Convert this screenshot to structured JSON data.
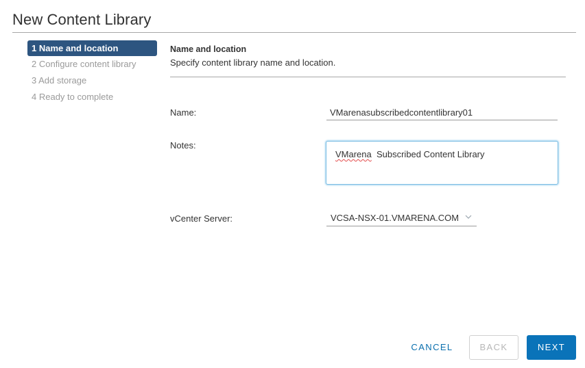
{
  "dialog": {
    "title": "New Content Library"
  },
  "steps": [
    {
      "label": "1 Name and location",
      "active": true
    },
    {
      "label": "2 Configure content library",
      "active": false
    },
    {
      "label": "3 Add storage",
      "active": false
    },
    {
      "label": "4 Ready to complete",
      "active": false
    }
  ],
  "section": {
    "title": "Name and location",
    "description": "Specify content library name and location."
  },
  "form": {
    "name_label": "Name:",
    "name_value": "VMarenasubscribedcontentlibrary01",
    "notes_label": "Notes:",
    "notes_misspelled_word": "VMarena",
    "notes_rest": "  Subscribed Content Library",
    "vcenter_label": "vCenter Server:",
    "vcenter_value": "VCSA-NSX-01.VMARENA.COM",
    "vcenter_icon": "chevron-down-icon"
  },
  "buttons": {
    "cancel": "CANCEL",
    "back": "BACK",
    "next": "NEXT"
  },
  "colors": {
    "active_step_bg": "#2d5580",
    "primary_button": "#0a73b9",
    "link_text": "#0a6fae",
    "focus_border": "#7cbde3"
  }
}
